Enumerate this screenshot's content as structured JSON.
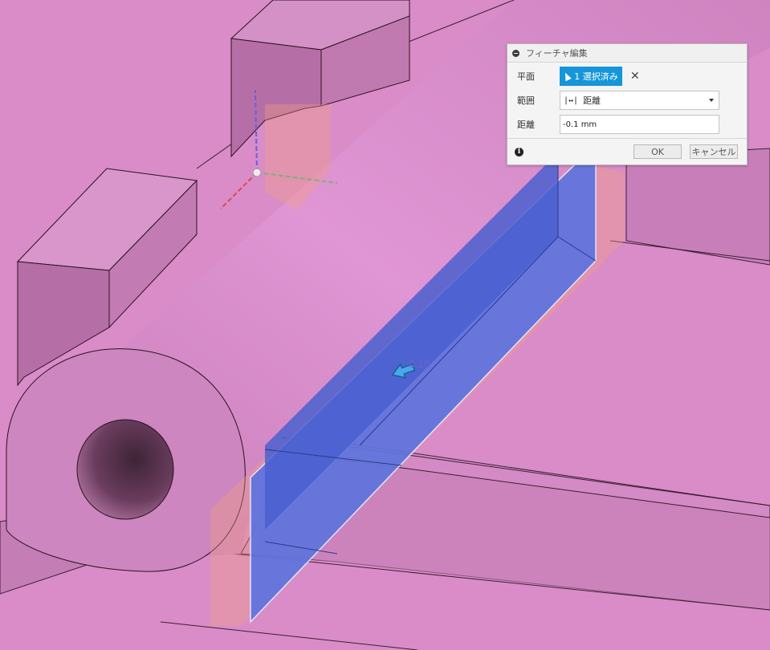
{
  "dialog": {
    "title": "フィーチャ編集",
    "plane_label": "平面",
    "plane_selection": "1 選択済み",
    "extent_label": "範囲",
    "extent_value": "距離",
    "distance_label": "距離",
    "distance_value": "-0.1 mm",
    "ok_label": "OK",
    "cancel_label": "キャンセル"
  },
  "viewport": {
    "dimension_label": "0.10",
    "model_color": "#d98cc8",
    "plane_color": "#5b73e0",
    "accent_color": "#1696d9"
  }
}
